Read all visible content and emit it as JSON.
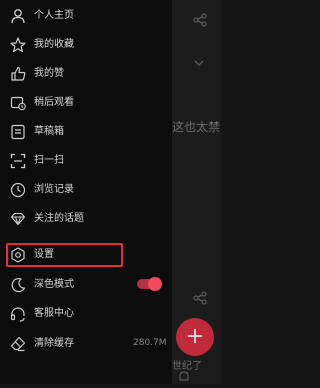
{
  "menu": {
    "items": [
      {
        "label": "个人主页",
        "icon": "person-icon"
      },
      {
        "label": "我的收藏",
        "icon": "star-icon"
      },
      {
        "label": "我的赞",
        "icon": "thumbs-up-icon"
      },
      {
        "label": "稍后观看",
        "icon": "watch-later-icon"
      },
      {
        "label": "草稿箱",
        "icon": "draft-icon"
      },
      {
        "label": "扫一扫",
        "icon": "scan-icon"
      },
      {
        "label": "浏览记录",
        "icon": "history-clock-icon"
      },
      {
        "label": "关注的话题",
        "icon": "diamond-icon"
      },
      {
        "label": "设置",
        "icon": "settings-gear-icon"
      },
      {
        "label": "深色模式",
        "icon": "moon-icon"
      },
      {
        "label": "客服中心",
        "icon": "headset-icon"
      },
      {
        "label": "清除缓存",
        "icon": "eraser-icon"
      }
    ],
    "dark_mode_enabled": true,
    "cache_size": "280.7M"
  },
  "background": {
    "snippet_text": "这也太禁",
    "bottom_text": "世纪了"
  },
  "colors": {
    "accent": "#e5302f",
    "toggle": "#f04a5d",
    "fab": "#c02a3b"
  }
}
